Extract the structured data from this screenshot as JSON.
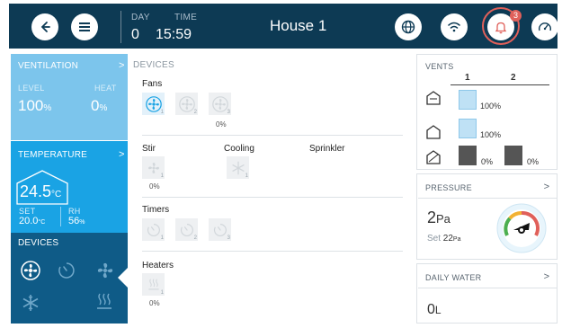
{
  "topbar": {
    "day_label": "DAY",
    "day_value": "0",
    "time_label": "TIME",
    "time_value": "15:59",
    "house_title": "House 1",
    "alarm_count": "3"
  },
  "ventilation": {
    "title": "VENTILATION",
    "level_label": "LEVEL",
    "level_value": "100",
    "level_unit": "%",
    "heat_label": "HEAT",
    "heat_value": "0",
    "heat_unit": "%"
  },
  "temperature": {
    "title": "TEMPERATURE",
    "value": "24.5",
    "unit": "°C",
    "set_label": "SET",
    "set_value": "20.0",
    "set_unit": "°C",
    "rh_label": "RH",
    "rh_value": "56",
    "rh_unit": "%"
  },
  "devices_panel": {
    "title": "DEVICES"
  },
  "devices": {
    "header": "DEVICES",
    "fans": {
      "title": "Fans",
      "subs": [
        "1",
        "2",
        "3"
      ],
      "percent": "0",
      "percent_unit": "%"
    },
    "stir": {
      "title": "Stir",
      "sub": "1",
      "percent": "0",
      "percent_unit": "%"
    },
    "cooling": {
      "title": "Cooling",
      "sub": "1"
    },
    "sprinkler": {
      "title": "Sprinkler"
    },
    "timers": {
      "title": "Timers",
      "subs": [
        "1",
        "2",
        "3"
      ]
    },
    "heaters": {
      "title": "Heaters",
      "sub": "1",
      "percent": "0",
      "percent_unit": "%"
    }
  },
  "vents": {
    "title": "VENTS",
    "columns": [
      "1",
      "2"
    ],
    "rows": [
      {
        "icon": "vent-open-icon",
        "values": [
          "100%"
        ],
        "level": [
          1.0
        ]
      },
      {
        "icon": "tunnel-icon",
        "values": [
          "100%"
        ],
        "level": [
          1.0
        ]
      },
      {
        "icon": "curtain-icon",
        "values": [
          "0%",
          "0%"
        ],
        "level": [
          0,
          0
        ]
      }
    ]
  },
  "pressure": {
    "title": "PRESSURE",
    "value": "2",
    "unit": "Pa",
    "set_label": "Set",
    "set_value": "22",
    "set_unit": "Pa"
  },
  "daily_water": {
    "title": "DAILY WATER",
    "value": "0",
    "unit": "L"
  },
  "colors": {
    "topbar": "#0d3a54",
    "ventilation": "#7cc5ec",
    "temperature": "#1aa3e4",
    "devices": "#0f5b87",
    "alarm": "#e0605a",
    "vent_open": "#bfe1f5",
    "vent_closed": "#555555"
  }
}
